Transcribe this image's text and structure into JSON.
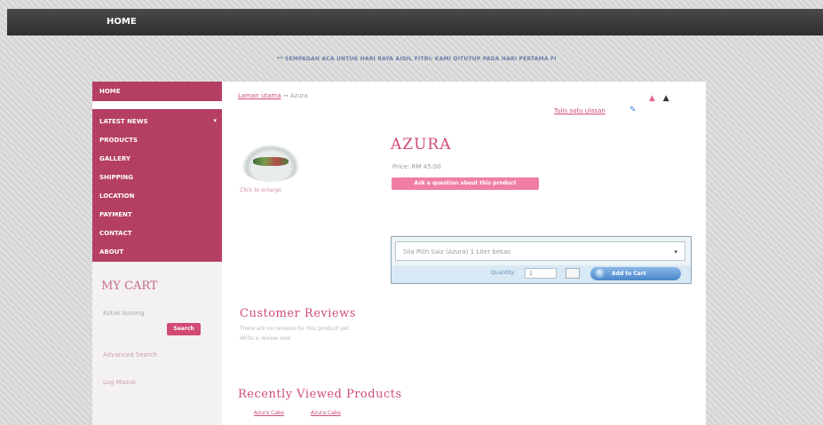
{
  "topbar": {
    "home": "HOME"
  },
  "marquee": "** SEMPADAN ACA UNTUK HARI RAYA AIDIL FITRI: KAMI DITUTUP PADA HARI PERTAMA FI",
  "sidebar": {
    "home": "HOME",
    "items": [
      {
        "label": "LATEST NEWS"
      },
      {
        "label": "PRODUCTS"
      },
      {
        "label": "GALLERY"
      },
      {
        "label": "SHIPPING"
      },
      {
        "label": "LOCATION"
      },
      {
        "label": "PAYMENT"
      },
      {
        "label": "CONTACT"
      },
      {
        "label": "ABOUT"
      }
    ],
    "cart_title": "MY CART",
    "cart_empty": "Kotak kosong",
    "search_button": "Search",
    "search_label": "Advanced Search",
    "footer_text": "Log Masuk"
  },
  "breadcrumb": {
    "link": "Laman utama",
    "sep": "→",
    "current": "Azura"
  },
  "nav_arrows": {
    "prev": "▲",
    "next": "▲"
  },
  "write_review": "Tulis satu ulasan",
  "product": {
    "title": "AZURA",
    "price": "Price: RM 45.00",
    "ask_button": "Ask a question about this product",
    "enlarge": "Click to enlarge",
    "option_text": "Sila Pilih Saiz (Azura) 1 Liter bekas",
    "qty_label": "Quantity:",
    "qty_value": "1",
    "add_to_cart": "Add to Cart"
  },
  "reviews": {
    "title": "Customer Reviews",
    "line1": "There are no reviews for this product yet.",
    "line2": "Write a review now"
  },
  "recent": {
    "title": "Recently Viewed Products",
    "links": [
      "Azura Cake",
      "Azura Cake"
    ]
  }
}
